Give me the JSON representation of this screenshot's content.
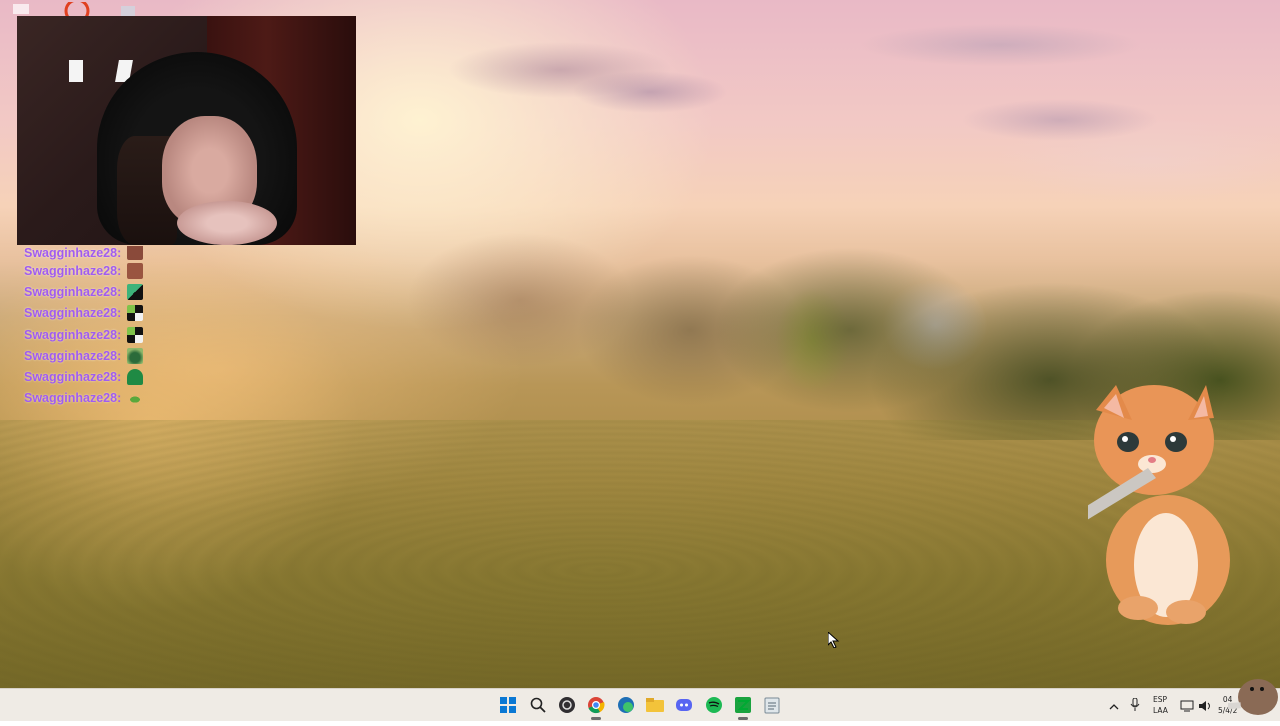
{
  "chat": {
    "messages": [
      {
        "user": "Swagginhaze28",
        "emote": "brown-face-emote"
      },
      {
        "user": "Swagginhaze28",
        "emote": "brown-face-emote"
      },
      {
        "user": "Swagginhaze28",
        "emote": "green-black-emote"
      },
      {
        "user": "Swagginhaze28",
        "emote": "checker-emote"
      },
      {
        "user": "Swagginhaze28",
        "emote": "checker-emote"
      },
      {
        "user": "Swagginhaze28",
        "emote": "frog-face-emote"
      },
      {
        "user": "Swagginhaze28",
        "emote": "green-blob-emote"
      },
      {
        "user": "Swagginhaze28",
        "emote": "frog-emote"
      }
    ],
    "separator": ":",
    "user_color": "#a05cf0"
  },
  "taskbar": {
    "apps": [
      "windows-start-icon",
      "search-icon",
      "obs-icon",
      "chrome-icon",
      "edge-icon",
      "file-explorer-icon",
      "discord-icon",
      "spotify-icon",
      "green-app-icon",
      "notepad-icon"
    ],
    "tray": {
      "lang_line1": "ESP",
      "lang_line2": "LAA",
      "time": "04",
      "date": "5/4/2"
    }
  },
  "colors": {
    "taskbar_bg": "#eeeae4",
    "accent": "#0078d4"
  }
}
